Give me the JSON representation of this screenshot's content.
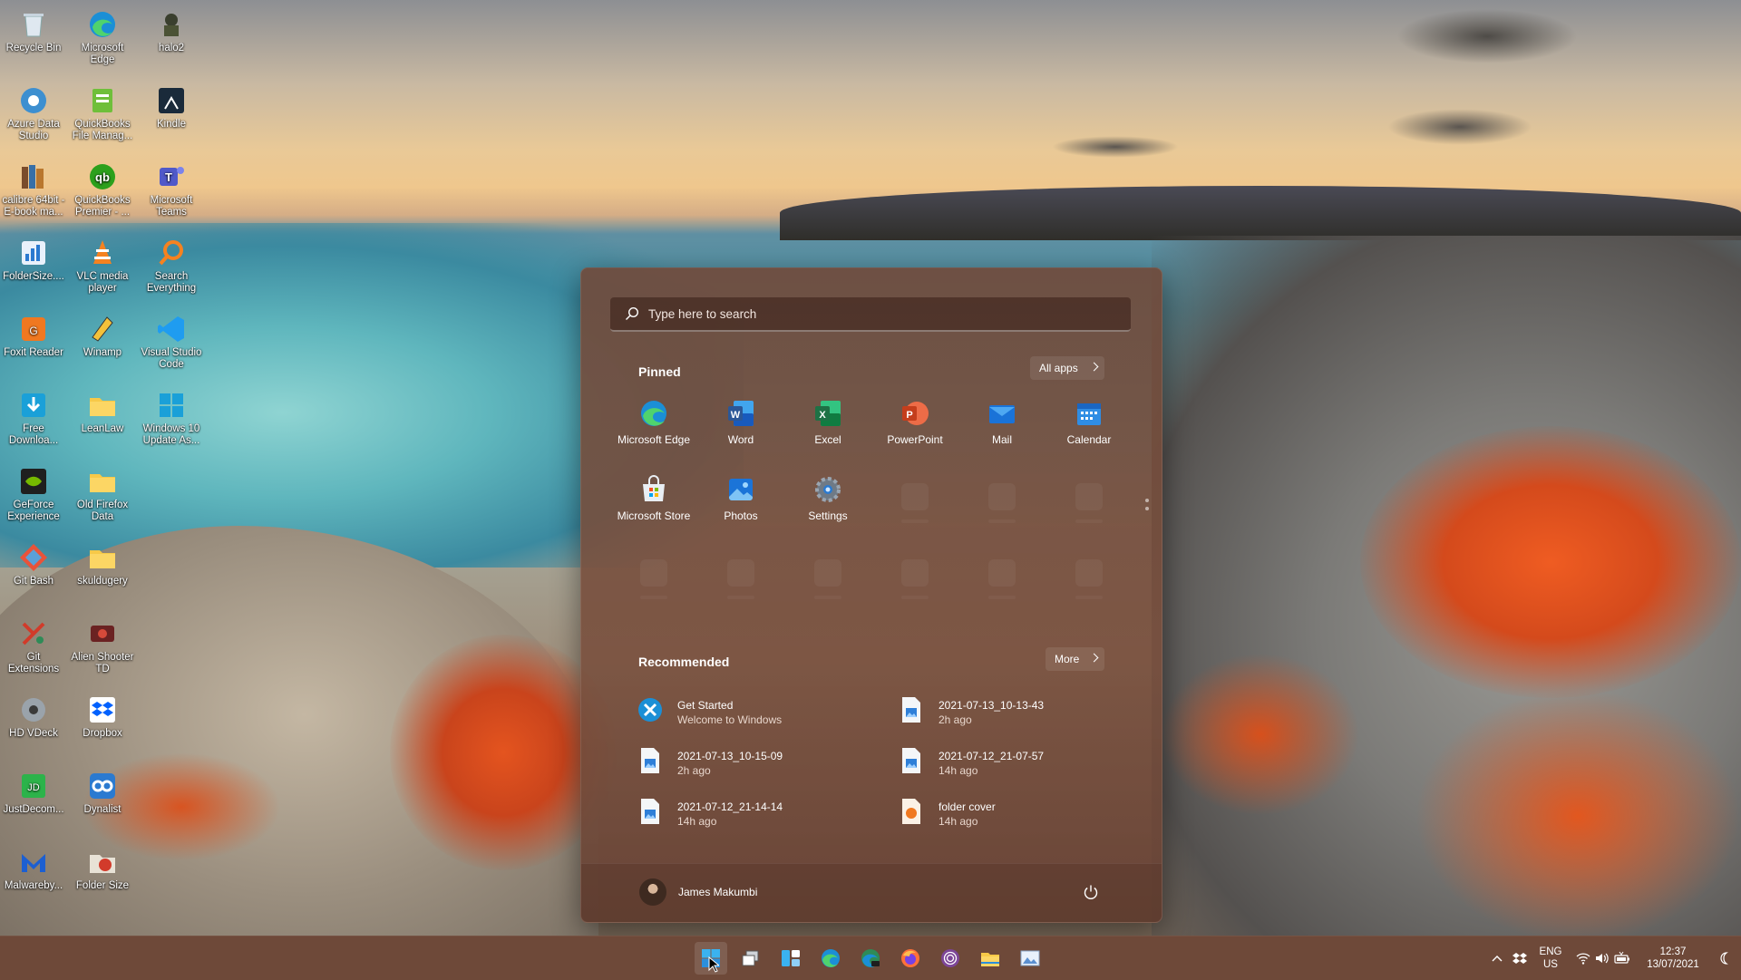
{
  "desktop": {
    "icons": [
      {
        "label": "Recycle Bin",
        "icon": "recycle-bin-icon"
      },
      {
        "label": "Microsoft Edge",
        "icon": "edge-icon"
      },
      {
        "label": "halo2",
        "icon": "halo2-icon"
      },
      {
        "label": "Azure Data Studio",
        "icon": "azure-data-studio-icon"
      },
      {
        "label": "QuickBooks File Manag...",
        "icon": "quickbooks-file-manager-icon"
      },
      {
        "label": "Kindle",
        "icon": "kindle-icon"
      },
      {
        "label": "calibre 64bit - E-book ma...",
        "icon": "calibre-icon"
      },
      {
        "label": "QuickBooks Premier - ...",
        "icon": "quickbooks-premier-icon"
      },
      {
        "label": "Microsoft Teams",
        "icon": "teams-icon"
      },
      {
        "label": "FolderSize....",
        "icon": "foldersize-icon"
      },
      {
        "label": "VLC media player",
        "icon": "vlc-icon"
      },
      {
        "label": "Search Everything",
        "icon": "search-everything-icon"
      },
      {
        "label": "Foxit Reader",
        "icon": "foxit-reader-icon"
      },
      {
        "label": "Winamp",
        "icon": "winamp-icon"
      },
      {
        "label": "Visual Studio Code",
        "icon": "vscode-icon"
      },
      {
        "label": "Free Downloa...",
        "icon": "free-download-manager-icon"
      },
      {
        "label": "LeanLaw",
        "icon": "folder-icon"
      },
      {
        "label": "Windows 10 Update As...",
        "icon": "windows-update-assistant-icon"
      },
      {
        "label": "GeForce Experience",
        "icon": "geforce-icon"
      },
      {
        "label": "Old Firefox Data",
        "icon": "folder-icon"
      },
      {
        "label": "Git Bash",
        "icon": "git-bash-icon"
      },
      {
        "label": "skuldugery",
        "icon": "folder-icon"
      },
      {
        "label": "Git Extensions",
        "icon": "git-extensions-icon"
      },
      {
        "label": "Alien Shooter TD",
        "icon": "alien-shooter-icon"
      },
      {
        "label": "HD VDeck",
        "icon": "hd-vdeck-icon"
      },
      {
        "label": "Dropbox",
        "icon": "dropbox-icon"
      },
      {
        "label": "JustDecom...",
        "icon": "justdecompile-icon"
      },
      {
        "label": "Dynalist",
        "icon": "dynalist-icon"
      },
      {
        "label": "Malwareby...",
        "icon": "malwarebytes-icon"
      },
      {
        "label": "Folder Size",
        "icon": "folder-size-icon"
      }
    ]
  },
  "start_menu": {
    "search_placeholder": "Type here to search",
    "pinned_title": "Pinned",
    "all_apps_label": "All apps",
    "pinned": [
      {
        "label": "Microsoft Edge",
        "icon": "edge-icon"
      },
      {
        "label": "Word",
        "icon": "word-icon"
      },
      {
        "label": "Excel",
        "icon": "excel-icon"
      },
      {
        "label": "PowerPoint",
        "icon": "powerpoint-icon"
      },
      {
        "label": "Mail",
        "icon": "mail-icon"
      },
      {
        "label": "Calendar",
        "icon": "calendar-icon"
      },
      {
        "label": "Microsoft Store",
        "icon": "store-icon"
      },
      {
        "label": "Photos",
        "icon": "photos-icon"
      },
      {
        "label": "Settings",
        "icon": "settings-icon"
      }
    ],
    "recommended_title": "Recommended",
    "more_label": "More",
    "recommended": [
      {
        "title": "Get Started",
        "subtitle": "Welcome to Windows",
        "icon": "get-started-icon"
      },
      {
        "title": "2021-07-13_10-13-43",
        "subtitle": "2h ago",
        "icon": "image-file-icon"
      },
      {
        "title": "2021-07-13_10-15-09",
        "subtitle": "2h ago",
        "icon": "image-file-icon"
      },
      {
        "title": "2021-07-12_21-07-57",
        "subtitle": "14h ago",
        "icon": "image-file-icon"
      },
      {
        "title": "2021-07-12_21-14-14",
        "subtitle": "14h ago",
        "icon": "image-file-icon"
      },
      {
        "title": "folder cover",
        "subtitle": "14h ago",
        "icon": "pdf-file-icon"
      }
    ],
    "user_name": "James Makumbi"
  },
  "taskbar": {
    "apps": [
      "start-icon",
      "task-view-icon",
      "widgets-icon",
      "edge-icon",
      "edge-dev-icon",
      "firefox-icon",
      "tor-browser-icon",
      "file-explorer-icon",
      "image-viewer-icon"
    ],
    "language_line1": "ENG",
    "language_line2": "US",
    "time": "12:37",
    "date": "13/07/2021"
  },
  "colors": {
    "accent": "#6e4939",
    "start_bg": "#75503f",
    "edge_blue": "#1b8fd6",
    "word_blue": "#2b5797",
    "excel_green": "#1e7145",
    "powerpoint_red": "#d24726"
  }
}
